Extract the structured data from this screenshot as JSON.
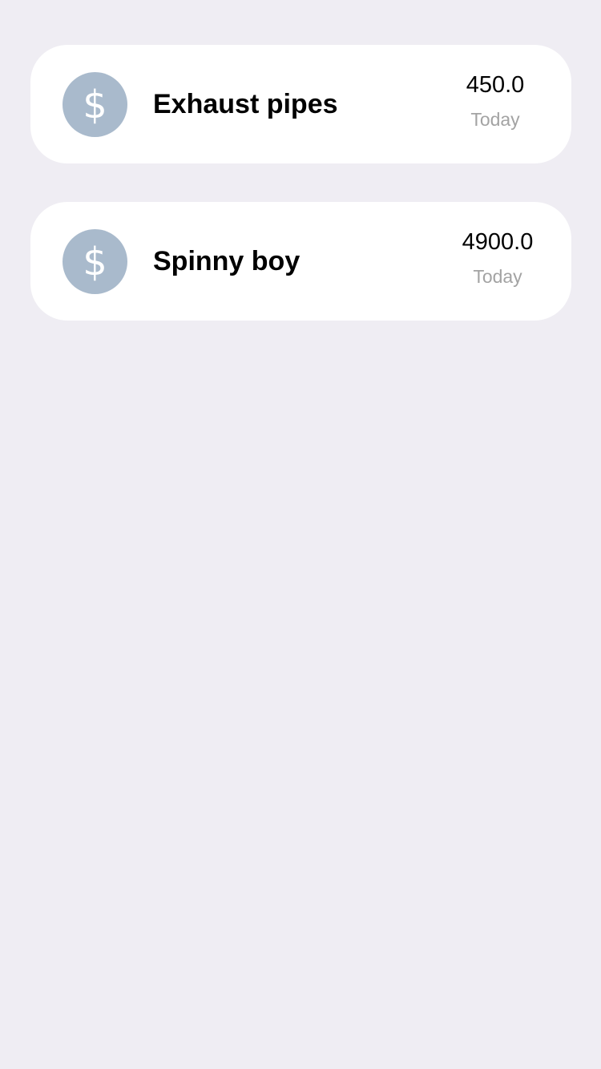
{
  "colors": {
    "background": "#efedf3",
    "card": "#ffffff",
    "icon_bg": "#a9bacc",
    "secondary_text": "#a3a3a3"
  },
  "transactions": [
    {
      "icon": "dollar-icon",
      "icon_glyph": "$",
      "title": "Exhaust pipes",
      "amount": "450.0",
      "date": "Today"
    },
    {
      "icon": "dollar-icon",
      "icon_glyph": "$",
      "title": "Spinny boy",
      "amount": "4900.0",
      "date": "Today"
    }
  ]
}
